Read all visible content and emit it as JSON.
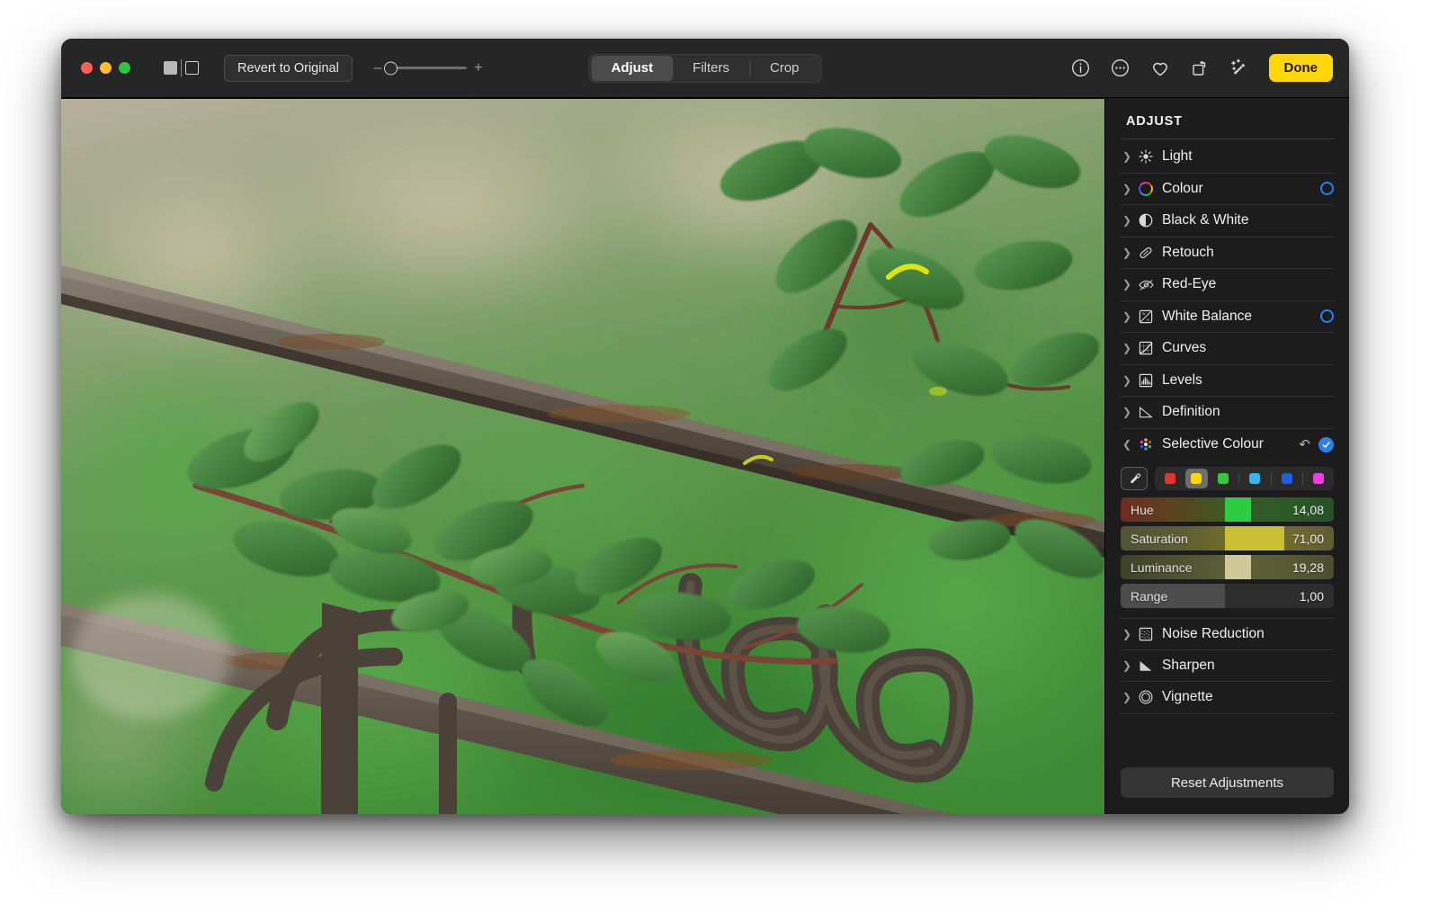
{
  "window": {
    "traffic_lights": [
      "close",
      "minimize",
      "zoom"
    ]
  },
  "toolbar": {
    "revert_label": "Revert to Original",
    "zoom_minus": "–",
    "zoom_plus": "+",
    "zoom_value": 0,
    "tabs": [
      {
        "label": "Adjust",
        "active": true
      },
      {
        "label": "Filters",
        "active": false
      },
      {
        "label": "Crop",
        "active": false
      }
    ],
    "icons": [
      "info-icon",
      "more-icon",
      "favorite-icon",
      "rotate-icon",
      "auto-enhance-icon"
    ],
    "done_label": "Done",
    "done_color": "#ffd60a"
  },
  "sidebar": {
    "title": "ADJUST",
    "accent_blue": "#2f7fe8",
    "items": [
      {
        "label": "Light",
        "icon": "brightness-icon",
        "expanded": false,
        "toggle": false
      },
      {
        "label": "Colour",
        "icon": "color-wheel-icon",
        "expanded": false,
        "toggle": true
      },
      {
        "label": "Black & White",
        "icon": "black-white-icon",
        "expanded": false,
        "toggle": false
      },
      {
        "label": "Retouch",
        "icon": "retouch-bandage-icon",
        "expanded": false,
        "toggle": false
      },
      {
        "label": "Red-Eye",
        "icon": "red-eye-icon",
        "expanded": false,
        "toggle": false
      },
      {
        "label": "White Balance",
        "icon": "white-balance-icon",
        "expanded": false,
        "toggle": true
      },
      {
        "label": "Curves",
        "icon": "curves-icon",
        "expanded": false,
        "toggle": false
      },
      {
        "label": "Levels",
        "icon": "levels-icon",
        "expanded": false,
        "toggle": false
      },
      {
        "label": "Definition",
        "icon": "definition-icon",
        "expanded": false,
        "toggle": false
      }
    ],
    "selective_colour": {
      "label": "Selective Colour",
      "icon": "selective-colour-icon",
      "expanded": true,
      "revert_icon": "revert-arrow-icon",
      "checked": true,
      "eyedropper_icon": "eyedropper-icon",
      "swatches": [
        {
          "name": "red",
          "color": "#e63329",
          "selected": false
        },
        {
          "name": "yellow",
          "color": "#ffd60a",
          "selected": true
        },
        {
          "name": "green",
          "color": "#2ecc40",
          "selected": false
        },
        {
          "name": "cyan",
          "color": "#2fb8f0",
          "selected": false
        },
        {
          "name": "blue",
          "color": "#1e5fe0",
          "selected": false
        },
        {
          "name": "magenta",
          "color": "#f23de0",
          "selected": false
        }
      ],
      "sliders": [
        {
          "label": "Hue",
          "value": "14,08",
          "knob_pct": 49
        },
        {
          "label": "Saturation",
          "value": "71,00",
          "knob_pct": 49
        },
        {
          "label": "Luminance",
          "value": "19,28",
          "knob_pct": 49
        },
        {
          "label": "Range",
          "value": "1,00",
          "knob_pct": 49
        }
      ]
    },
    "items_after": [
      {
        "label": "Noise Reduction",
        "icon": "noise-reduction-icon",
        "expanded": false,
        "toggle": false
      },
      {
        "label": "Sharpen",
        "icon": "sharpen-icon",
        "expanded": false,
        "toggle": false
      },
      {
        "label": "Vignette",
        "icon": "vignette-icon",
        "expanded": false,
        "toggle": false
      }
    ],
    "reset_label": "Reset Adjustments"
  },
  "canvas": {
    "photo_description": "rusty iron fence with green leafy branches on blurred green background"
  }
}
